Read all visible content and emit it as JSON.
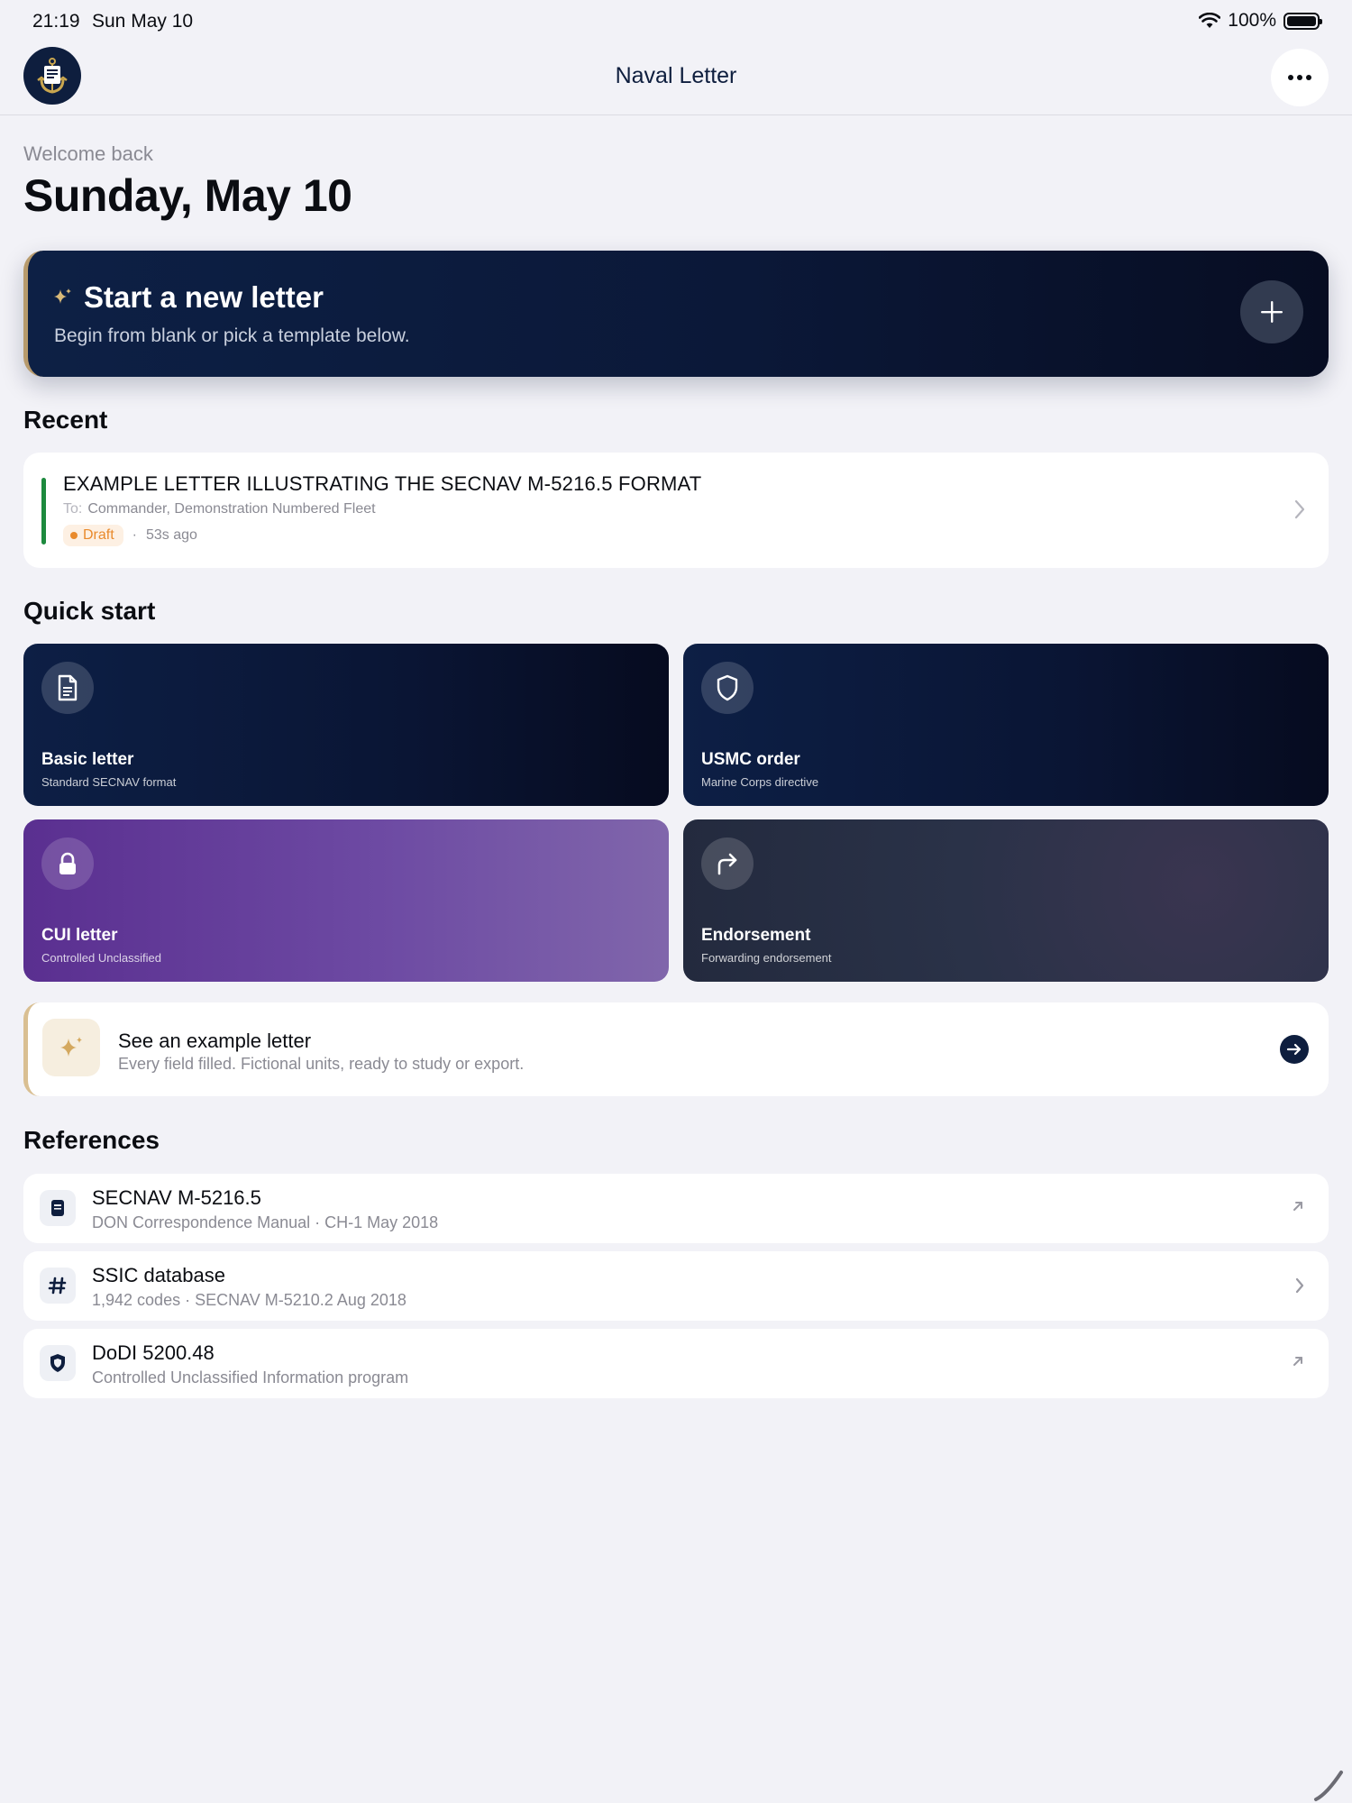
{
  "status": {
    "time": "21:19",
    "date": "Sun May 10",
    "battery": "100%"
  },
  "nav": {
    "title": "Naval Letter"
  },
  "header": {
    "welcome": "Welcome back",
    "date": "Sunday, May 10"
  },
  "hero": {
    "title": "Start a new letter",
    "subtitle": "Begin from blank or pick a template below."
  },
  "recent": {
    "section_title": "Recent",
    "items": [
      {
        "title": "EXAMPLE LETTER ILLUSTRATING THE SECNAV M-5216.5 FORMAT",
        "to_label": "To:",
        "to": "Commander, Demonstration Numbered Fleet",
        "status": "Draft",
        "separator": "·",
        "time": "53s ago"
      }
    ]
  },
  "quick_start": {
    "section_title": "Quick start",
    "tiles": [
      {
        "title": "Basic letter",
        "subtitle": "Standard SECNAV format",
        "icon": "document-icon"
      },
      {
        "title": "USMC order",
        "subtitle": "Marine Corps directive",
        "icon": "shield-icon"
      },
      {
        "title": "CUI letter",
        "subtitle": "Controlled Unclassified",
        "icon": "lock-icon"
      },
      {
        "title": "Endorsement",
        "subtitle": "Forwarding endorsement",
        "icon": "forward-arrow-icon"
      }
    ]
  },
  "example": {
    "title": "See an example letter",
    "subtitle": "Every field filled. Fictional units, ready to study or export."
  },
  "references": {
    "section_title": "References",
    "items": [
      {
        "title": "SECNAV M-5216.5",
        "subtitle": "DON Correspondence Manual · CH-1 May 2018",
        "icon": "book-icon",
        "trail": "external-link-icon"
      },
      {
        "title": "SSIC database",
        "subtitle": "1,942 codes · SECNAV M-5210.2 Aug 2018",
        "icon": "hashtag-icon",
        "trail": "chevron-right-icon"
      },
      {
        "title": "DoDI 5200.48",
        "subtitle": "Controlled Unclassified Information program",
        "icon": "shield-icon",
        "trail": "external-link-icon"
      }
    ]
  },
  "colors": {
    "navy": "#0e1e3e",
    "accent_green": "#1d8a3e",
    "draft_orange": "#e98a2c",
    "gold": "#b79a6c",
    "background": "#f2f2f7"
  }
}
